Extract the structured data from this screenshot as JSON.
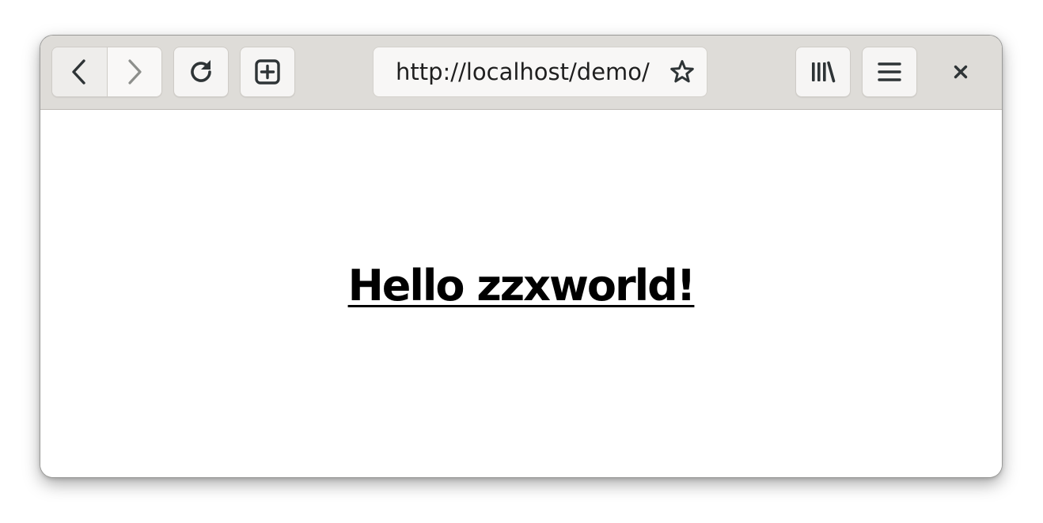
{
  "toolbar": {
    "back_icon": "chevron-left-icon",
    "forward_icon": "chevron-right-icon",
    "reload_icon": "reload-icon",
    "new_tab_icon": "new-tab-plus-icon",
    "bookmark_icon": "star-icon",
    "library_icon": "library-icon",
    "menu_icon": "hamburger-menu-icon",
    "close_icon": "close-icon"
  },
  "address_bar": {
    "url": "http://localhost/demo/"
  },
  "page": {
    "heading_link_text": "Hello zzxworld!"
  },
  "colors": {
    "toolbar_bg": "#dedcd8",
    "button_bg": "#f6f5f4",
    "page_bg": "#ffffff",
    "text": "#000000"
  }
}
